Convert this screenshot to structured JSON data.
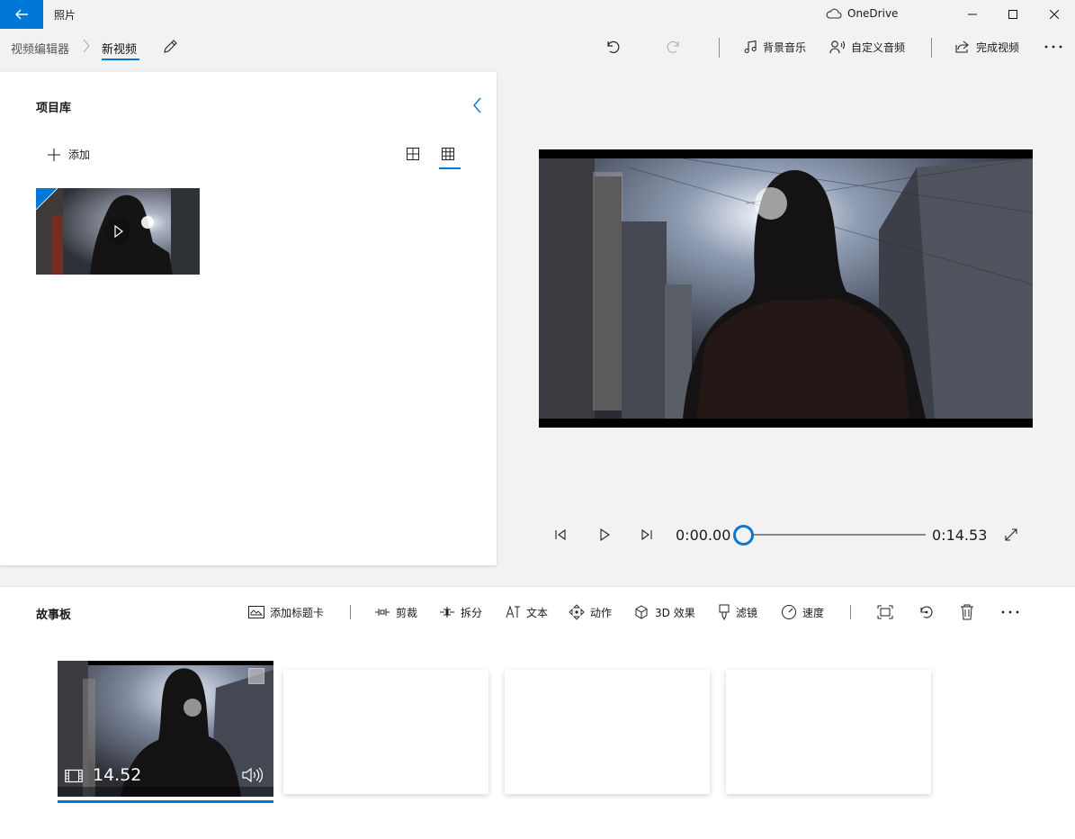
{
  "app": {
    "title": "照片",
    "onedrive_label": "OneDrive"
  },
  "window_controls": {
    "minimize": "minimize-icon",
    "maximize": "maximize-icon",
    "close": "close-icon"
  },
  "breadcrumb": {
    "root": "视频编辑器",
    "current": "新视频"
  },
  "toolbar": {
    "background_music": "背景音乐",
    "custom_audio": "自定义音频",
    "finish_video": "完成视频"
  },
  "library": {
    "title": "项目库",
    "add_label": "添加"
  },
  "player": {
    "time_current": "0:00.00",
    "time_total": "0:14.53",
    "progress": 0
  },
  "storyboard": {
    "title": "故事板",
    "actions": {
      "add_title_card": "添加标题卡",
      "trim": "剪裁",
      "split": "拆分",
      "text": "文本",
      "motion": "动作",
      "effects_3d": "3D 效果",
      "filters": "滤镜",
      "speed": "速度"
    },
    "clips": [
      {
        "duration": "14.52"
      }
    ]
  },
  "colors": {
    "accent": "#0078d7"
  }
}
